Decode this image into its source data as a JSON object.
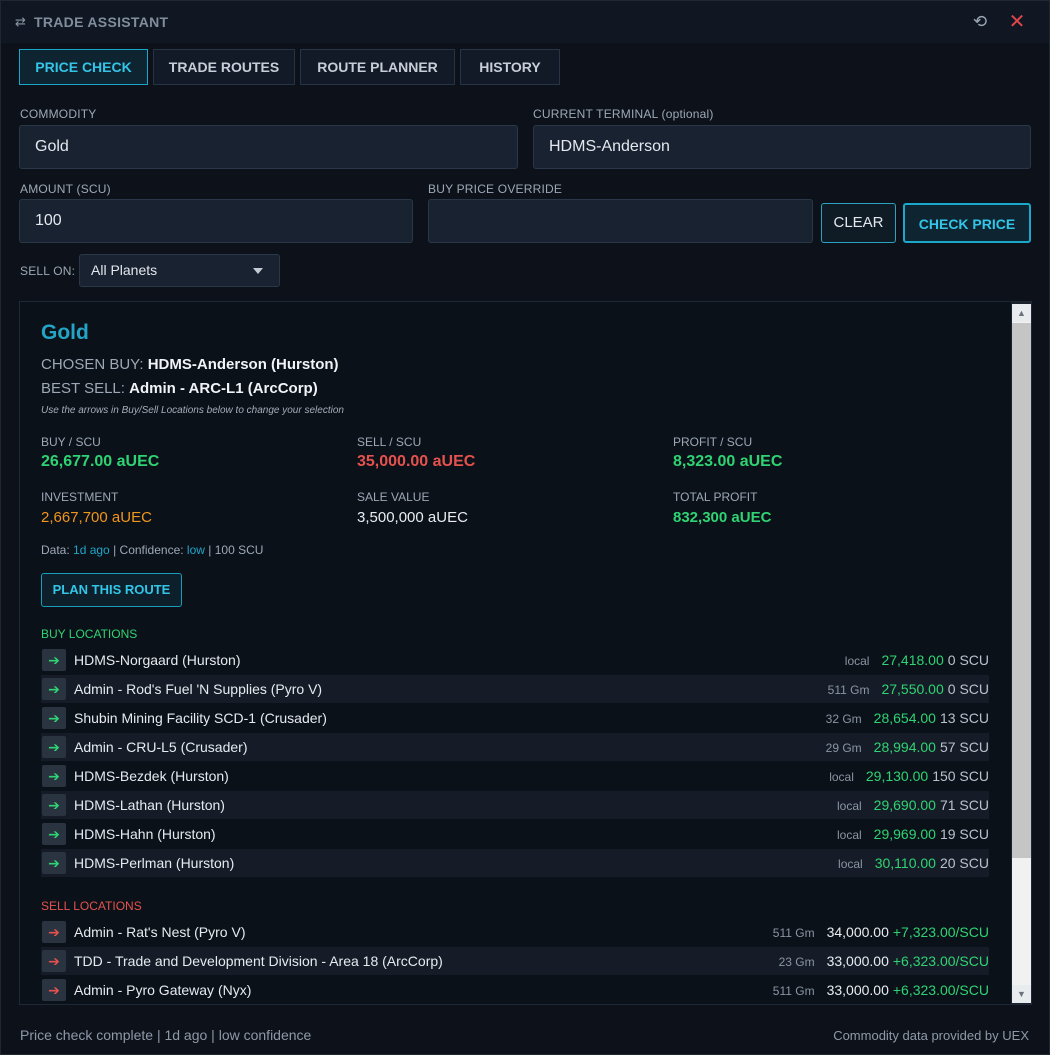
{
  "window": {
    "title": "TRADE ASSISTANT",
    "app_icon": "swap-arrows-icon",
    "refresh_icon": "refresh-icon",
    "close_icon": "close-icon"
  },
  "tabs": [
    {
      "label": "PRICE CHECK",
      "active": true
    },
    {
      "label": "TRADE ROUTES",
      "active": false
    },
    {
      "label": "ROUTE PLANNER",
      "active": false
    },
    {
      "label": "HISTORY",
      "active": false
    }
  ],
  "form": {
    "commodity_label": "COMMODITY",
    "commodity_value": "Gold",
    "terminal_label": "CURRENT TERMINAL (optional)",
    "terminal_value": "HDMS-Anderson",
    "amount_label": "AMOUNT (SCU)",
    "amount_value": "100",
    "override_label": "BUY PRICE OVERRIDE",
    "override_value": "",
    "clear_label": "CLEAR",
    "check_label": "CHECK PRICE",
    "sell_on_label": "SELL ON:",
    "sell_on_value": "All Planets"
  },
  "result": {
    "commodity": "Gold",
    "chosen_buy_label": "CHOSEN BUY:",
    "chosen_buy_value": "HDMS-Anderson (Hurston)",
    "best_sell_label": "BEST SELL:",
    "best_sell_value": "Admin - ARC-L1 (ArcCorp)",
    "hint": "Use the arrows in Buy/Sell Locations below to change your selection",
    "stats": {
      "buy_label": "BUY / SCU",
      "buy_value": "26,677.00 aUEC",
      "sell_label": "SELL / SCU",
      "sell_value": "35,000.00 aUEC",
      "profit_label": "PROFIT / SCU",
      "profit_value": "8,323.00 aUEC",
      "investment_label": "INVESTMENT",
      "investment_value": "2,667,700 aUEC",
      "sale_label": "SALE VALUE",
      "sale_value": "3,500,000 aUEC",
      "total_label": "TOTAL PROFIT",
      "total_value": "832,300 aUEC"
    },
    "meta": {
      "data_prefix": "Data:",
      "age": "1d ago",
      "confidence_prefix": "| Confidence:",
      "confidence": "low",
      "amount_suffix": "| 100 SCU"
    },
    "plan_button": "PLAN THIS ROUTE",
    "buy_section_title": "BUY LOCATIONS",
    "buy_locations": [
      {
        "name": "HDMS-Norgaard (Hurston)",
        "distance": "local",
        "price": "27,418.00",
        "scu": "0 SCU"
      },
      {
        "name": "Admin - Rod's Fuel 'N Supplies (Pyro V)",
        "distance": "511 Gm",
        "price": "27,550.00",
        "scu": "0 SCU"
      },
      {
        "name": "Shubin Mining Facility SCD-1 (Crusader)",
        "distance": "32 Gm",
        "price": "28,654.00",
        "scu": "13 SCU"
      },
      {
        "name": "Admin - CRU-L5 (Crusader)",
        "distance": "29 Gm",
        "price": "28,994.00",
        "scu": "57 SCU"
      },
      {
        "name": "HDMS-Bezdek (Hurston)",
        "distance": "local",
        "price": "29,130.00",
        "scu": "150 SCU"
      },
      {
        "name": "HDMS-Lathan (Hurston)",
        "distance": "local",
        "price": "29,690.00",
        "scu": "71 SCU"
      },
      {
        "name": "HDMS-Hahn (Hurston)",
        "distance": "local",
        "price": "29,969.00",
        "scu": "19 SCU"
      },
      {
        "name": "HDMS-Perlman (Hurston)",
        "distance": "local",
        "price": "30,110.00",
        "scu": "20 SCU"
      }
    ],
    "sell_section_title": "SELL LOCATIONS",
    "sell_locations": [
      {
        "name": "Admin - Rat's Nest (Pyro V)",
        "distance": "511 Gm",
        "price": "34,000.00",
        "profit": "+7,323.00/SCU"
      },
      {
        "name": "TDD - Trade and Development Division - Area 18 (ArcCorp)",
        "distance": "23 Gm",
        "price": "33,000.00",
        "profit": "+6,323.00/SCU"
      },
      {
        "name": "Admin - Pyro Gateway (Nyx)",
        "distance": "511 Gm",
        "price": "33,000.00",
        "profit": "+6,323.00/SCU"
      }
    ]
  },
  "status": {
    "left": "Price check complete | 1d ago | low confidence",
    "right": "Commodity data provided by UEX"
  },
  "colors": {
    "accent": "#1aa9cb",
    "positive": "#2fd373",
    "negative": "#e5524d",
    "investment": "#f1961c",
    "background": "#0d121a"
  }
}
